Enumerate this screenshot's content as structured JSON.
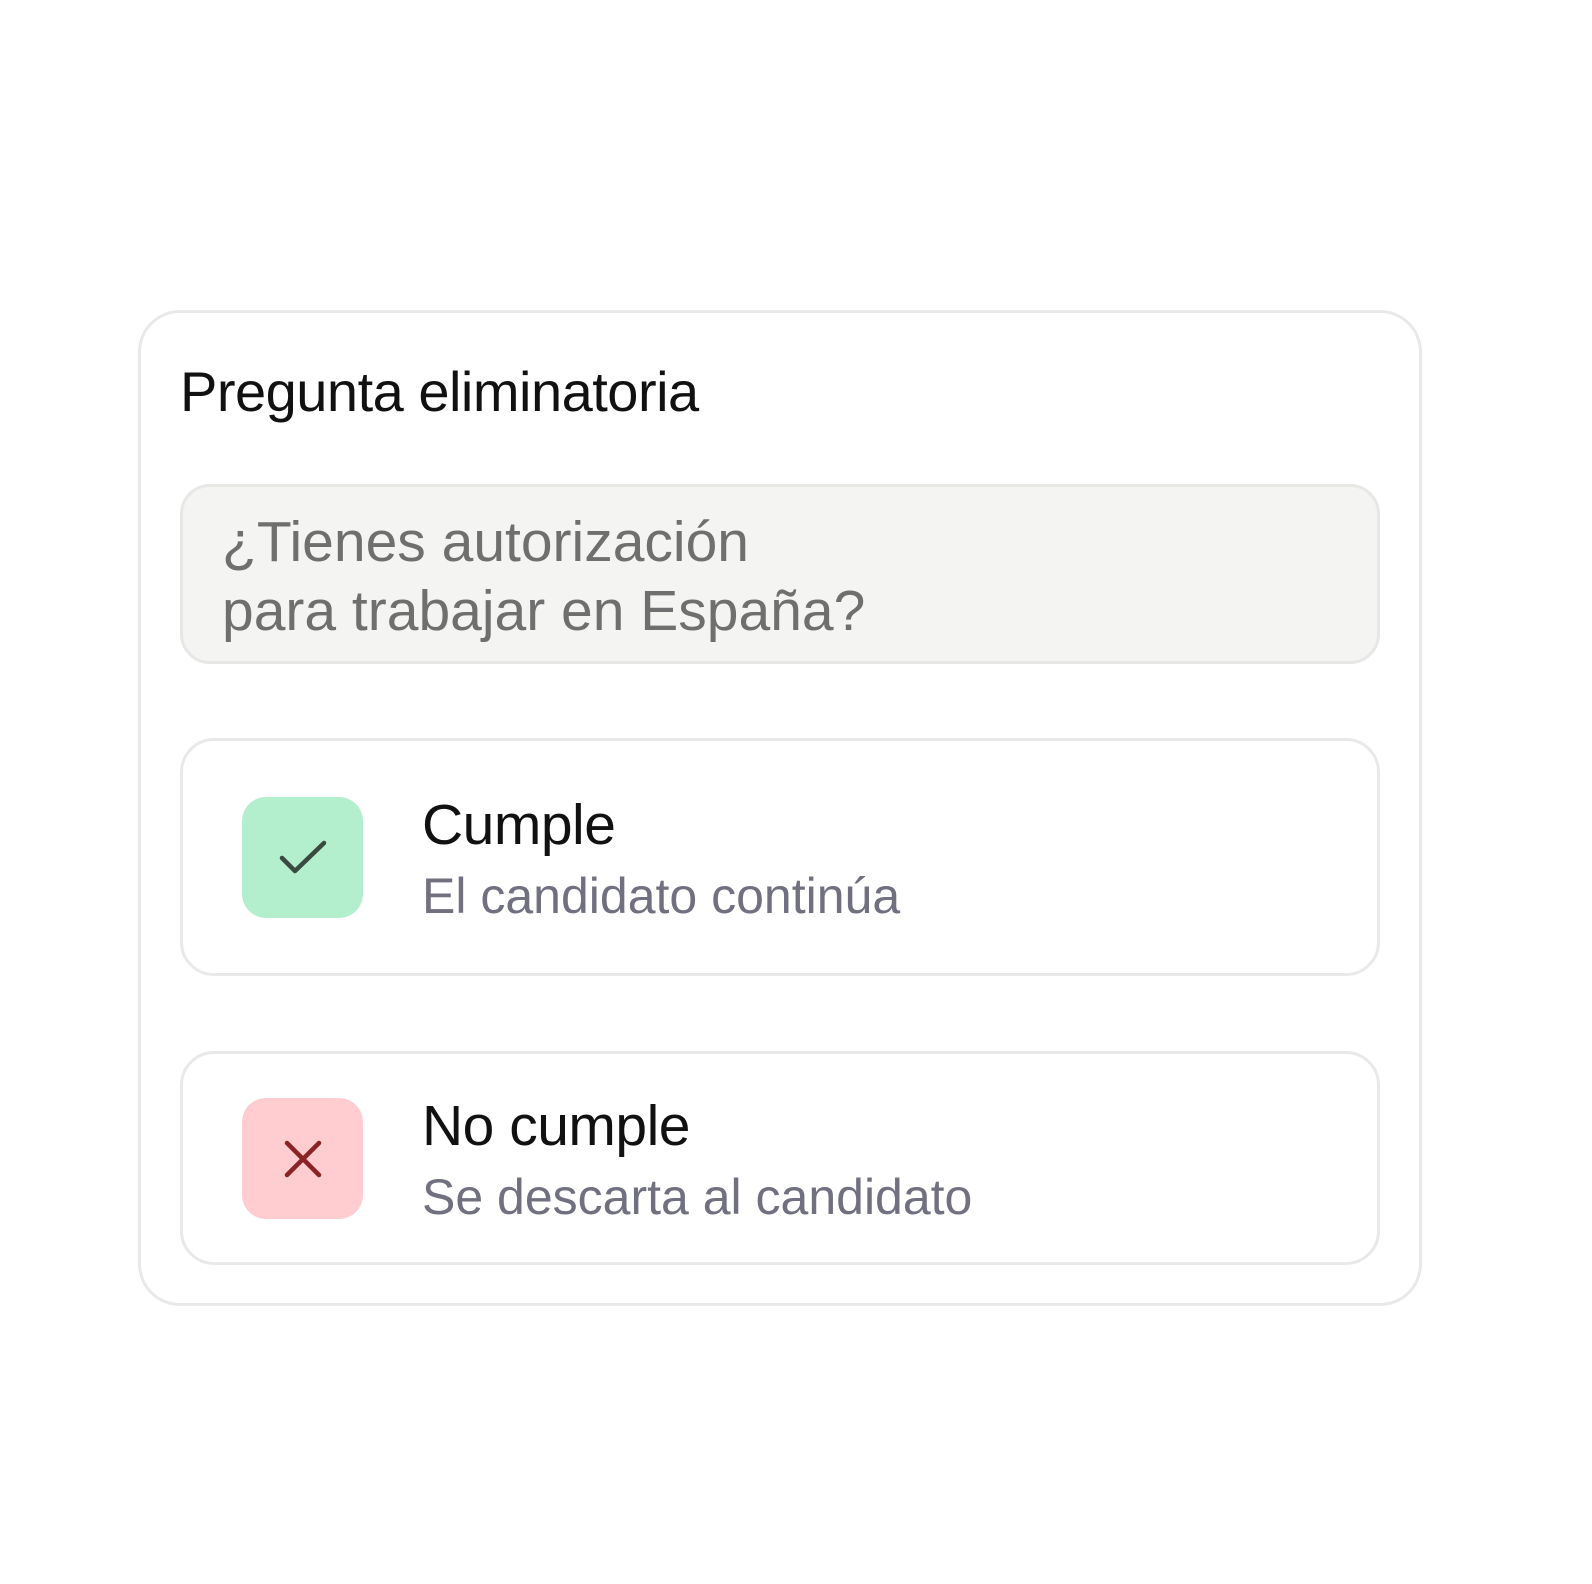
{
  "card": {
    "title": "Pregunta eliminatoria",
    "question_lines": [
      "¿Tienes autorización",
      "para trabajar en España?"
    ]
  },
  "options": [
    {
      "title": "Cumple",
      "subtitle": "El candidato continúa",
      "icon": "check-icon",
      "badge_color": "#b4efcd",
      "icon_color": "#3a4a40"
    },
    {
      "title": "No cumple",
      "subtitle": "Se descarta al candidato",
      "icon": "close-icon",
      "badge_color": "#ffcdd0",
      "icon_color": "#8a2424"
    }
  ]
}
